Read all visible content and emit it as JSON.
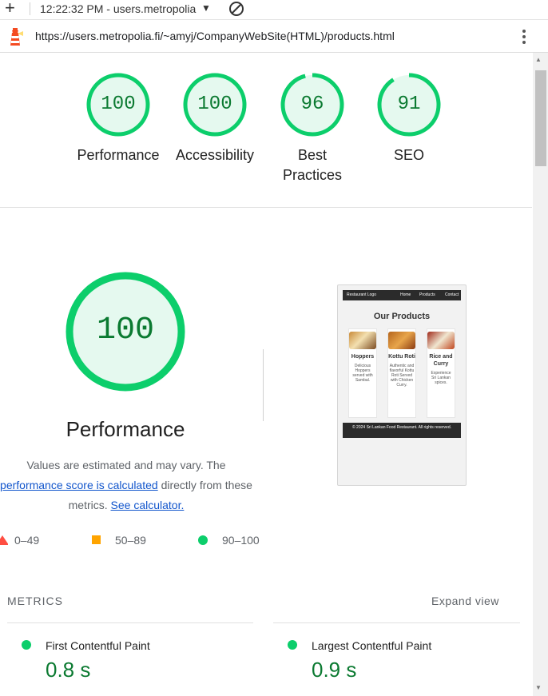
{
  "browser": {
    "tab_title": "12:22:32 PM - users.metropolia",
    "url": "https://users.metropolia.fi/~amyj/CompanyWebSite(HTML)/products.html"
  },
  "scores": [
    {
      "label": "Performance",
      "value": "100",
      "score": 100
    },
    {
      "label": "Accessibility",
      "value": "100",
      "score": 100
    },
    {
      "label": "Best Practices",
      "value": "96",
      "score": 96
    },
    {
      "label": "SEO",
      "value": "91",
      "score": 91
    }
  ],
  "performance": {
    "score": "100",
    "title": "Performance",
    "desc_line1": "Values are estimated and may vary. The",
    "desc_link1": "performance score is calculated",
    "desc_line2": "directly from these",
    "desc_line3": "metrics.",
    "desc_link2": "See calculator."
  },
  "legend": {
    "fail": "0–49",
    "average": "50–89",
    "pass": "90–100"
  },
  "screenshot": {
    "nav_logo": "Restaurant Logo",
    "nav_items": [
      "Home",
      "Products",
      "Contact"
    ],
    "heading": "Our Products",
    "cards": [
      {
        "title": "Hoppers",
        "desc": "Delicious Hoppers served with Sambal."
      },
      {
        "title": "Kottu Roti",
        "desc": "Authentic and flavorful Kottu Roti Served with Chicken Curry."
      },
      {
        "title": "Rice and Curry",
        "desc": "Experience Sri Lankan spices."
      }
    ],
    "footer": "© 2024 Sri Lankan Food Restaurant. All rights reserved."
  },
  "metrics": {
    "header": "METRICS",
    "expand_label": "Expand view",
    "items": [
      {
        "label": "First Contentful Paint",
        "value": "0.8 s"
      },
      {
        "label": "Largest Contentful Paint",
        "value": "0.9 s"
      }
    ]
  },
  "colors": {
    "pass": "#0cce6b",
    "pass_text": "#0b7a31",
    "average": "#ffa400",
    "link": "#1155cc"
  },
  "icons": [
    "plus-icon",
    "dropdown-caret-icon",
    "blocked-icon",
    "lighthouse-icon",
    "kebab-menu-icon"
  ]
}
